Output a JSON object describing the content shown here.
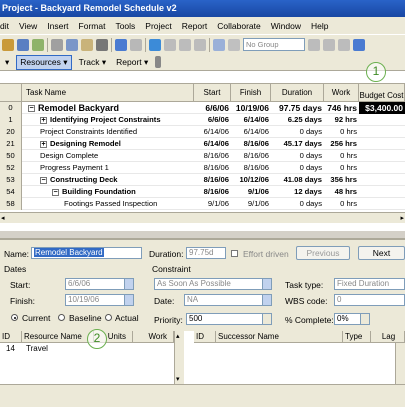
{
  "window": {
    "title": "Project - Backyard Remodel Schedule v2"
  },
  "menu": [
    "dit",
    "View",
    "Insert",
    "Format",
    "Tools",
    "Project",
    "Report",
    "Collaborate",
    "Window",
    "Help"
  ],
  "toolbar": {
    "group_combo": "No Group"
  },
  "toolbar2": {
    "resources": "Resources",
    "track": "Track",
    "report": "Report"
  },
  "grid": {
    "headers": {
      "task_name": "Task Name",
      "start": "Start",
      "finish": "Finish",
      "duration": "Duration",
      "work": "Work",
      "budget_cost": "Budget Cost"
    },
    "rows": [
      {
        "id": "0",
        "name": "Remodel Backyard",
        "start": "6/6/06",
        "finish": "10/19/06",
        "duration": "97.75 days",
        "work": "746 hrs",
        "cost": "$3,400.00",
        "level": 0,
        "bold": true,
        "toggle": "−"
      },
      {
        "id": "1",
        "name": "Identifying Project Constraints",
        "start": "6/6/06",
        "finish": "6/14/06",
        "duration": "6.25 days",
        "work": "92 hrs",
        "cost": "",
        "level": 1,
        "bold": true,
        "toggle": "+"
      },
      {
        "id": "20",
        "name": "Project Constraints Identified",
        "start": "6/14/06",
        "finish": "6/14/06",
        "duration": "0 days",
        "work": "0 hrs",
        "cost": "",
        "level": 1,
        "bold": false,
        "toggle": ""
      },
      {
        "id": "21",
        "name": "Designing Remodel",
        "start": "6/14/06",
        "finish": "8/16/06",
        "duration": "45.17 days",
        "work": "256 hrs",
        "cost": "",
        "level": 1,
        "bold": true,
        "toggle": "+"
      },
      {
        "id": "50",
        "name": "Design Complete",
        "start": "8/16/06",
        "finish": "8/16/06",
        "duration": "0 days",
        "work": "0 hrs",
        "cost": "",
        "level": 1,
        "bold": false,
        "toggle": ""
      },
      {
        "id": "52",
        "name": "Progress Payment 1",
        "start": "8/16/06",
        "finish": "8/16/06",
        "duration": "0 days",
        "work": "0 hrs",
        "cost": "",
        "level": 1,
        "bold": false,
        "toggle": ""
      },
      {
        "id": "53",
        "name": "Constructing Deck",
        "start": "8/16/06",
        "finish": "10/12/06",
        "duration": "41.08 days",
        "work": "356 hrs",
        "cost": "",
        "level": 1,
        "bold": true,
        "toggle": "−"
      },
      {
        "id": "54",
        "name": "Building Foundation",
        "start": "8/16/06",
        "finish": "9/1/06",
        "duration": "12 days",
        "work": "48 hrs",
        "cost": "",
        "level": 2,
        "bold": true,
        "toggle": "−"
      },
      {
        "id": "58",
        "name": "Footings Passed Inspection",
        "start": "9/1/06",
        "finish": "9/1/06",
        "duration": "0 days",
        "work": "0 hrs",
        "cost": "",
        "level": 3,
        "bold": false,
        "toggle": ""
      }
    ]
  },
  "form": {
    "name_label": "Name:",
    "name_value": "Remodel Backyard",
    "duration_label": "Duration:",
    "duration_value": "97.75d",
    "effort_label": "Effort driven",
    "previous": "Previous",
    "next": "Next",
    "dates_label": "Dates",
    "start_label": "Start:",
    "start_value": "6/6/06",
    "finish_label": "Finish:",
    "finish_value": "10/19/06",
    "constraint_label": "Constraint",
    "constraint_value": "As Soon As Possible",
    "date_label": "Date:",
    "date_value": "NA",
    "task_type_label": "Task type:",
    "task_type_value": "Fixed Duration",
    "wbs_label": "WBS code:",
    "wbs_value": "0",
    "current": "Current",
    "baseline": "Baseline",
    "actual": "Actual",
    "priority_label": "Priority:",
    "priority_value": "500",
    "complete_label": "% Complete:",
    "complete_value": "0%"
  },
  "resources_table": {
    "headers": {
      "id": "ID",
      "name": "Resource Name",
      "units": "Units",
      "work": "Work"
    },
    "rows": [
      {
        "id": "14",
        "name": "Travel"
      }
    ]
  },
  "successors_table": {
    "headers": {
      "id": "ID",
      "name": "Successor Name",
      "type": "Type",
      "lag": "Lag"
    }
  },
  "callouts": {
    "one": "1",
    "two": "2"
  }
}
